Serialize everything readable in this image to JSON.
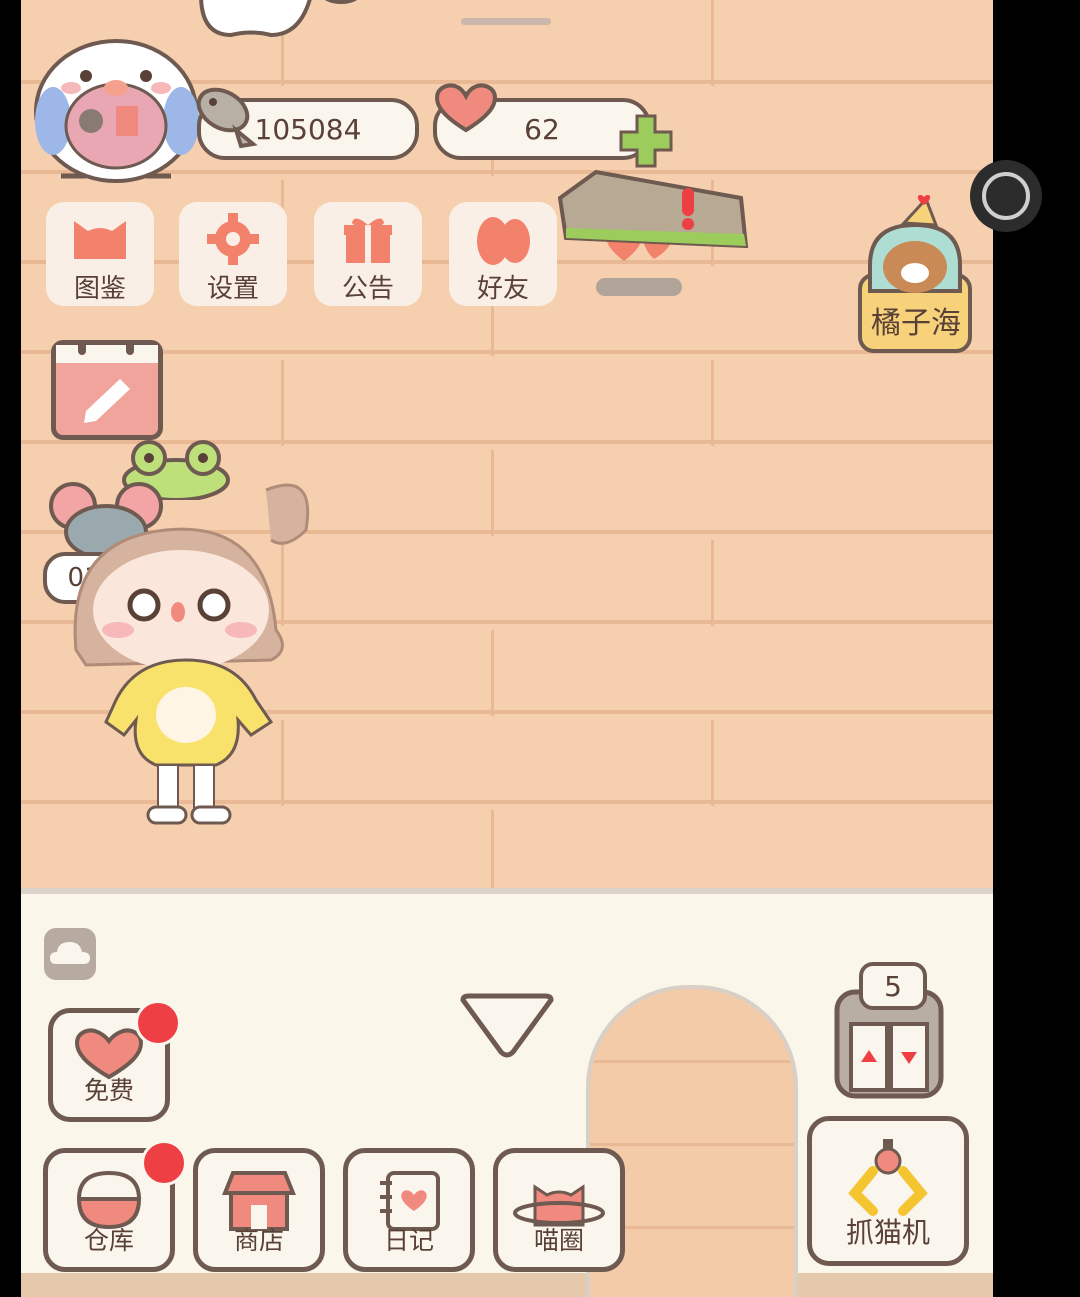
{
  "currency": {
    "fish_coins": "105084",
    "hearts": "62"
  },
  "top_menu": [
    {
      "label": "图鉴",
      "icon": "cat-head-icon"
    },
    {
      "label": "设置",
      "icon": "gear-icon"
    },
    {
      "label": "公告",
      "icon": "gift-icon"
    },
    {
      "label": "好友",
      "icon": "friends-icon"
    }
  ],
  "event": {
    "timer": "01:57"
  },
  "side_event": {
    "label": "橘子海"
  },
  "elevator": {
    "floor": "5"
  },
  "bottom_buttons": {
    "free": "免费",
    "warehouse": "仓库",
    "shop": "商店",
    "diary": "日记",
    "cat_circle": "喵圈",
    "claw_machine": "抓猫机"
  },
  "colors": {
    "wall": "#f6cfae",
    "outline": "#6e5a50",
    "accent_red": "#ee3f45",
    "icon_coral": "#f2826b"
  }
}
